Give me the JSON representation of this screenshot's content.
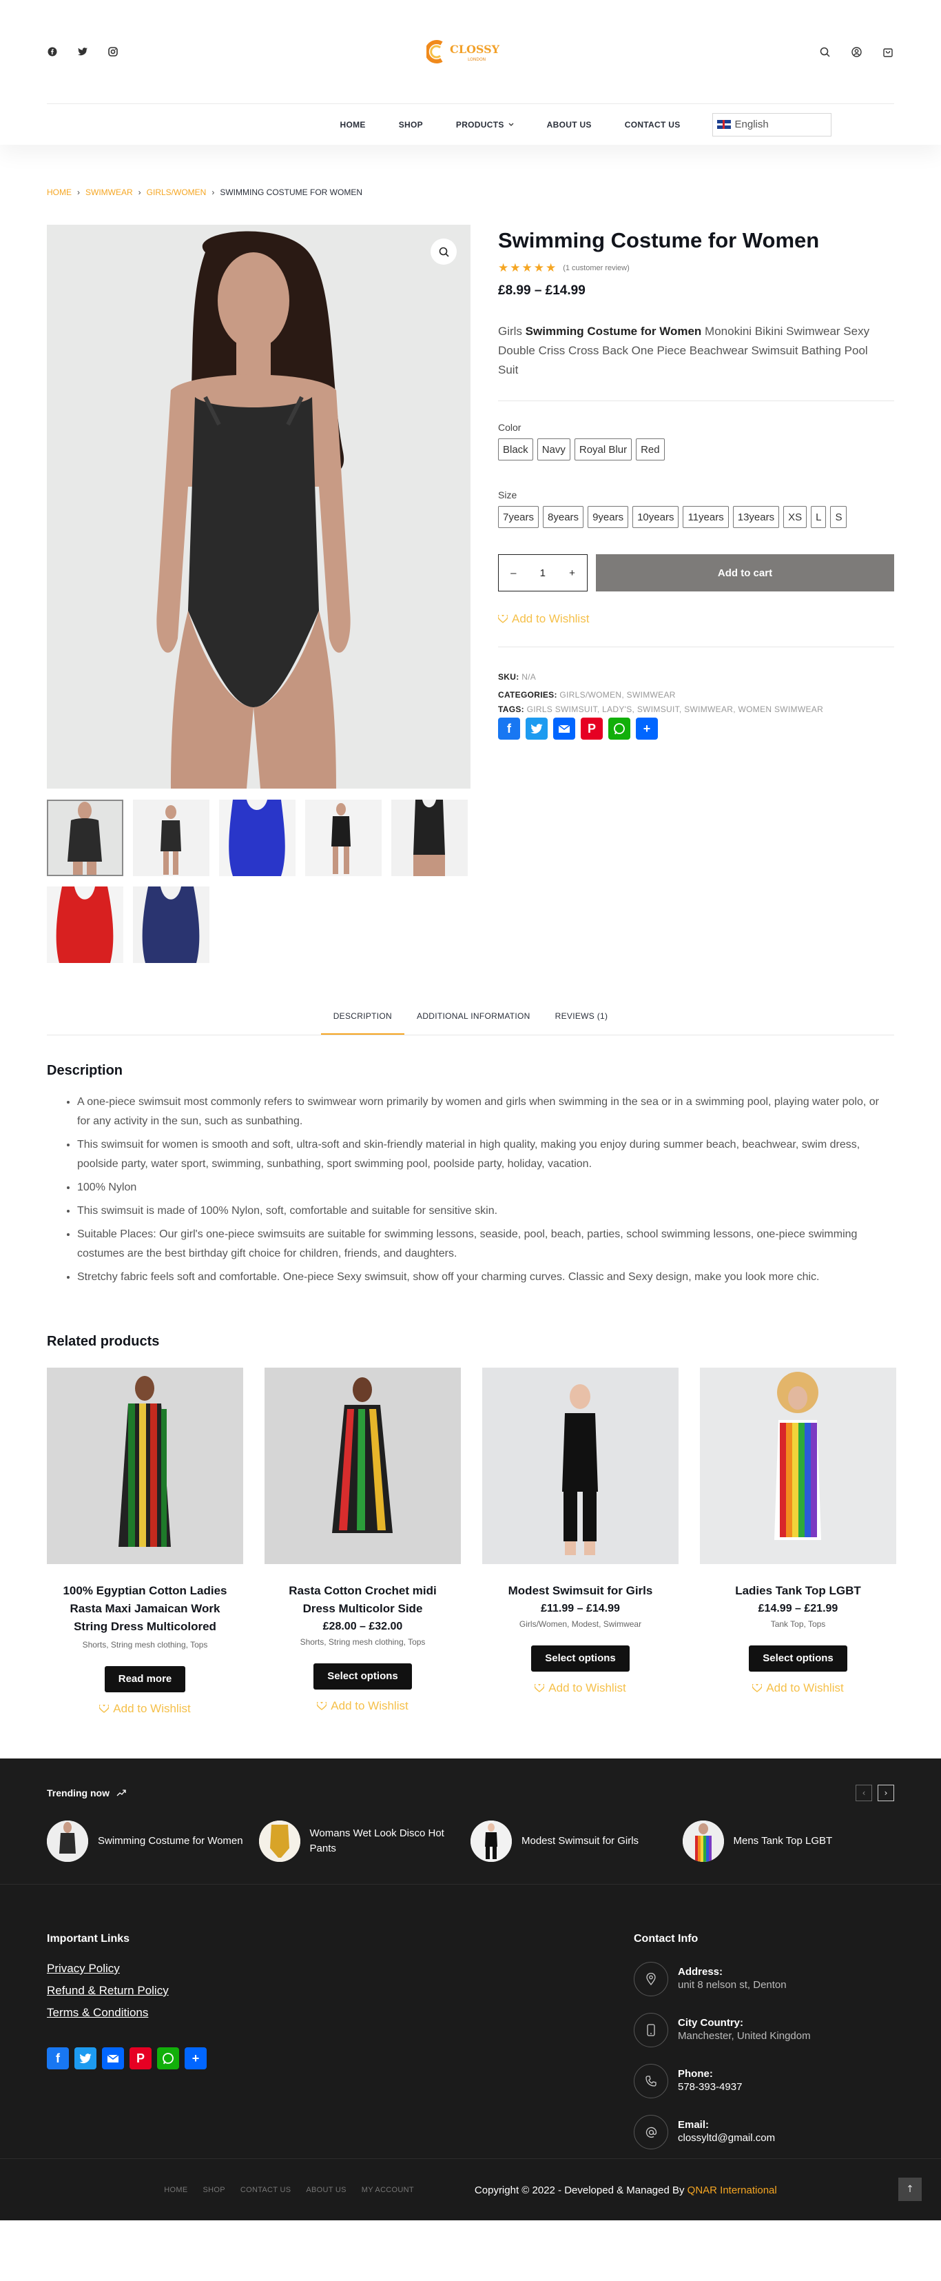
{
  "header": {
    "logo_text": "CLOSSY",
    "logo_sub": "LONDON",
    "nav": [
      {
        "label": "HOME"
      },
      {
        "label": "SHOP"
      },
      {
        "label": "PRODUCTS"
      },
      {
        "label": "ABOUT US"
      },
      {
        "label": "CONTACT US"
      }
    ],
    "language": "English"
  },
  "breadcrumb": {
    "items": [
      "HOME",
      "SWIMWEAR",
      "GIRLS/WOMEN"
    ],
    "current": "SWIMMING COSTUME FOR WOMEN"
  },
  "product": {
    "title": "Swimming Costume for Women",
    "stars": "★★★★★",
    "review_count": "(1 customer review)",
    "price": "£8.99 – £14.99",
    "desc_prefix": "Girls ",
    "desc_bold": "Swimming Costume for Women",
    "desc_rest": " Monokini Bikini Swimwear Sexy Double Criss Cross Back One Piece Beachwear Swimsuit Bathing Pool Suit",
    "color_label": "Color",
    "colors": [
      "Black",
      "Navy",
      "Royal Blur",
      "Red"
    ],
    "size_label": "Size",
    "sizes": [
      "7years",
      "8years",
      "9years",
      "10years",
      "11years",
      "13years",
      "XS",
      "L",
      "S"
    ],
    "qty": "1",
    "qty_minus": "–",
    "qty_plus": "+",
    "add_to_cart": "Add to cart",
    "wishlist": "Add to Wishlist",
    "sku_label": "SKU:",
    "sku": "N/A",
    "categories_label": "CATEGORIES:",
    "categories": [
      "GIRLS/WOMEN",
      "SWIMWEAR"
    ],
    "tags_label": "TAGS:",
    "tags": [
      "GIRLS SWIMSUIT",
      "LADY'S",
      "SWIMSUIT",
      "SWIMWEAR",
      "WOMEN SWIMWEAR"
    ],
    "thumb_colors": [
      "#2b2b2b",
      "#2b2b2b",
      "#2936c9",
      "#1d1d1d",
      "#222222",
      "#d82020",
      "#2a3470"
    ]
  },
  "tabs": [
    {
      "label": "DESCRIPTION",
      "active": true
    },
    {
      "label": "ADDITIONAL INFORMATION",
      "active": false
    },
    {
      "label": "REVIEWS (1)",
      "active": false
    }
  ],
  "description": {
    "title": "Description",
    "points": [
      "A one-piece swimsuit most commonly refers to swimwear worn primarily by women and girls when swimming in the sea or in a swimming pool, playing water polo, or for any activity in the sun, such as sunbathing.",
      "This swimsuit for women is smooth and soft, ultra-soft and skin-friendly material in high quality, making you enjoy during summer beach, beachwear, swim dress, poolside party, water sport, swimming, sunbathing, sport swimming pool, poolside party, holiday, vacation.",
      "100% Nylon",
      "This swimsuit is made of 100% Nylon, soft, comfortable and suitable for sensitive skin.",
      "Suitable Places: Our girl's one-piece swimsuits are suitable for swimming lessons, seaside, pool, beach, parties, school swimming lessons, one-piece swimming costumes are the best birthday gift choice for children, friends, and daughters.",
      "Stretchy fabric feels soft and comfortable. One-piece Sexy swimsuit, show off your charming curves. Classic and Sexy design, make you look more chic."
    ]
  },
  "related": {
    "title": "Related products",
    "products": [
      {
        "title": "100% Egyptian Cotton Ladies Rasta Maxi Jamaican Work String Dress Multicolored",
        "price": "",
        "cats": "Shorts, String mesh clothing, Tops",
        "button": "Read more",
        "wishlist": "Add to Wishlist",
        "bg": "#d8d8d8"
      },
      {
        "title": "Rasta Cotton Crochet midi Dress Multicolor Side",
        "price": "£28.00 – £32.00",
        "cats": "Shorts, String mesh clothing, Tops",
        "button": "Select options",
        "wishlist": "Add to Wishlist",
        "bg": "#d6d6d6"
      },
      {
        "title": "Modest Swimsuit for Girls",
        "price": "£11.99 – £14.99",
        "cats": "Girls/Women, Modest, Swimwear",
        "button": "Select options",
        "wishlist": "Add to Wishlist",
        "bg": "#e3e4e6"
      },
      {
        "title": "Ladies Tank Top LGBT",
        "price": "£14.99 – £21.99",
        "cats": "Tank Top, Tops",
        "button": "Select options",
        "wishlist": "Add to Wishlist",
        "bg": "#e8e9ea"
      }
    ]
  },
  "trending": {
    "title": "Trending now",
    "prev": "‹",
    "next": "›",
    "items": [
      {
        "name": "Swimming Costume for Women"
      },
      {
        "name": "Womans Wet Look Disco Hot Pants"
      },
      {
        "name": "Modest Swimsuit for Girls"
      },
      {
        "name": "Mens Tank Top LGBT"
      }
    ]
  },
  "footer": {
    "links_title": "Important Links",
    "links": [
      "Privacy Policy",
      "Refund & Return Policy",
      "Terms & Conditions"
    ],
    "contact_title": "Contact Info",
    "contacts": [
      {
        "label": "Address:",
        "value": "unit 8 nelson st, Denton",
        "icon": "location-icon"
      },
      {
        "label": "City Country:",
        "value": "Manchester, United Kingdom",
        "icon": "phone-device-icon"
      },
      {
        "label": "Phone:",
        "value": "578-393-4937",
        "icon": "phone-icon"
      },
      {
        "label": "Email:",
        "value": "clossyltd@gmail.com",
        "icon": "at-icon"
      }
    ],
    "bottom_nav": [
      "HOME",
      "SHOP",
      "CONTACT US",
      "ABOUT US",
      "MY ACCOUNT"
    ],
    "copyright": "Copyright © 2022 - Developed & Managed By ",
    "brand": "QNAR International",
    "to_top": "↑"
  },
  "colors": {
    "accent": "#f5a623",
    "wishlist": "#f5c04a",
    "cart_button": "#7d7b79",
    "footer_bg": "#1b1b1b",
    "facebook": "#1877f2",
    "twitter": "#1d9bf0",
    "email": "#0166ff",
    "pinterest": "#e60023",
    "whatsapp": "#12af0a",
    "share": "#0166ff"
  }
}
